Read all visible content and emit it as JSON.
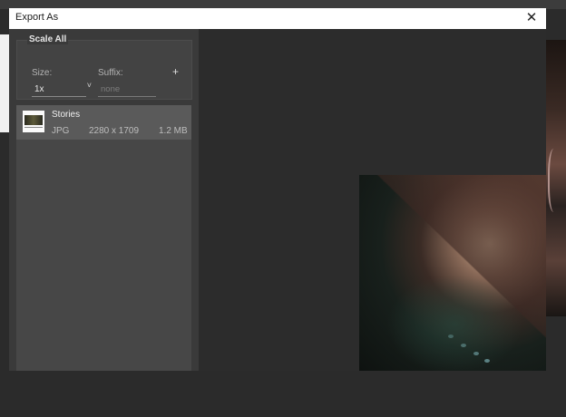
{
  "dialog": {
    "title": "Export As",
    "close_glyph": "✕"
  },
  "scale_all": {
    "heading": "Scale All",
    "size_label": "Size:",
    "suffix_label": "Suffix:",
    "add_glyph": "+",
    "size_value": "1x",
    "suffix_placeholder": "none"
  },
  "files": [
    {
      "name": "Stories",
      "format": "JPG",
      "dimensions": "2280 x 1709",
      "size": "1.2 MB"
    }
  ],
  "icons": {
    "close": "close-icon",
    "add": "plus-icon",
    "dropdown": "chevron-down-icon"
  }
}
